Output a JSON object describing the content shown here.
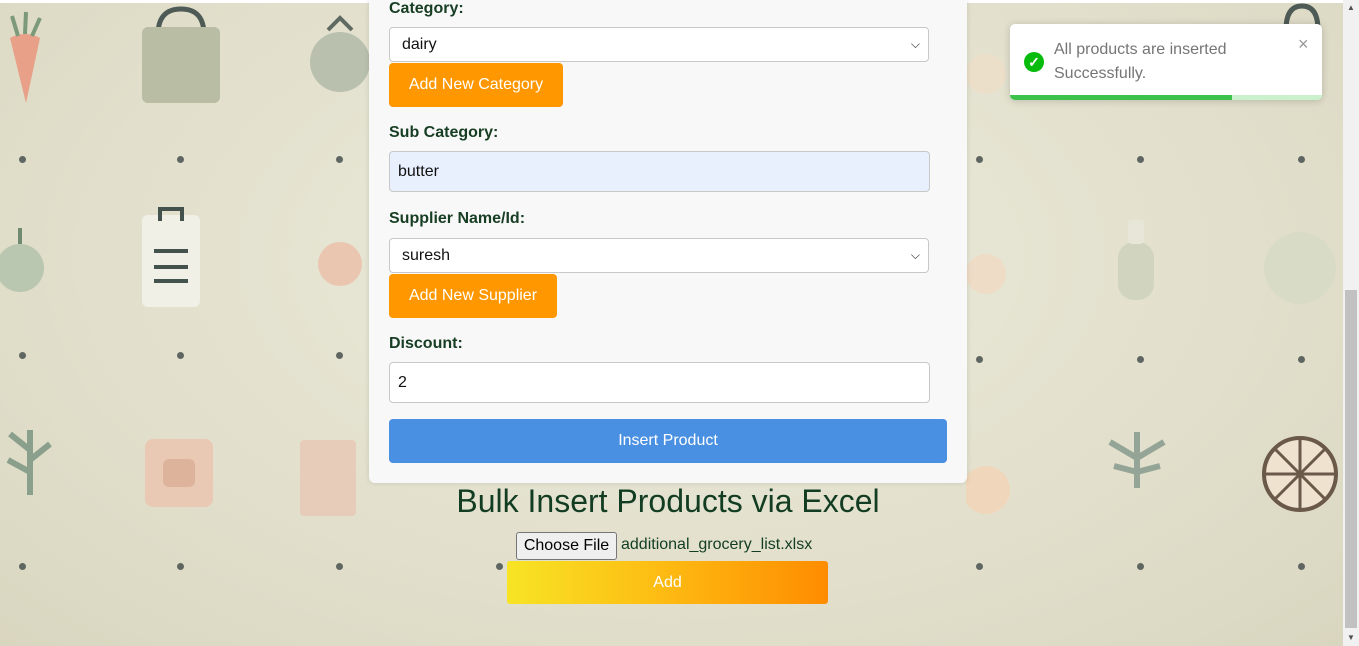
{
  "form": {
    "category_label": "Category:",
    "category_value": "dairy",
    "add_category_label": "Add New Category",
    "subcategory_label": "Sub Category:",
    "subcategory_value": "butter",
    "supplier_label": "Supplier Name/Id:",
    "supplier_value": "suresh",
    "add_supplier_label": "Add New Supplier",
    "discount_label": "Discount:",
    "discount_value": "2",
    "insert_label": "Insert Product"
  },
  "bulk": {
    "title": "Bulk Insert Products via Excel",
    "choose_file_label": "Choose File",
    "file_name": "additional_grocery_list.xlsx",
    "add_label": "Add"
  },
  "toast": {
    "message": "All products are inserted Successfully.",
    "progress_fraction": 0.71,
    "accent": "#07bc0c"
  },
  "colors": {
    "orange": "#ff9800",
    "blue": "#4a90e2",
    "label_green": "#173d23"
  }
}
